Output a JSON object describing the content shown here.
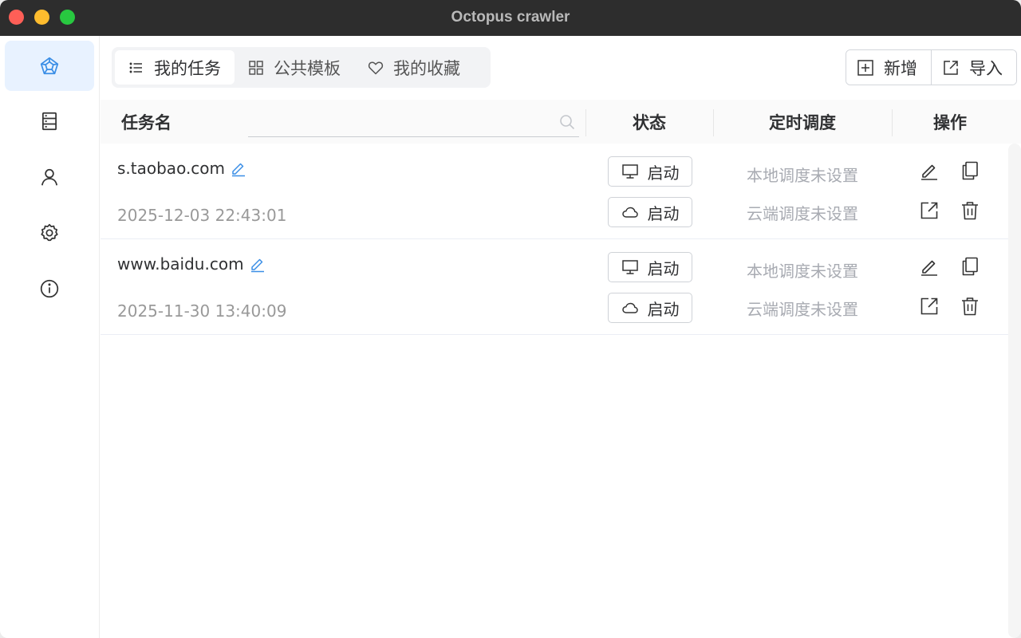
{
  "window": {
    "title": "Octopus crawler"
  },
  "sidebar": {
    "items": [
      {
        "icon": "octopus-logo-icon",
        "active": true
      },
      {
        "icon": "server-icon"
      },
      {
        "icon": "user-icon"
      },
      {
        "icon": "gear-icon"
      },
      {
        "icon": "info-icon"
      }
    ]
  },
  "tabs": [
    {
      "label": "我的任务",
      "icon": "list-icon",
      "active": true
    },
    {
      "label": "公共模板",
      "icon": "grid-icon"
    },
    {
      "label": "我的收藏",
      "icon": "heart-icon"
    }
  ],
  "actions": {
    "add_label": "新增",
    "import_label": "导入"
  },
  "table": {
    "headers": {
      "name": "任务名",
      "status": "状态",
      "schedule": "定时调度",
      "ops": "操作"
    },
    "search": {
      "value": "",
      "placeholder": ""
    },
    "rows": [
      {
        "name": "s.taobao.com",
        "time": "2025-12-03 22:43:01",
        "local_start": "启动",
        "cloud_start": "启动",
        "local_schedule": "本地调度未设置",
        "cloud_schedule": "云端调度未设置"
      },
      {
        "name": "www.baidu.com",
        "time": "2025-11-30 13:40:09",
        "local_start": "启动",
        "cloud_start": "启动",
        "local_schedule": "本地调度未设置",
        "cloud_schedule": "云端调度未设置"
      }
    ]
  },
  "colors": {
    "accent": "#3a8ee6",
    "active_bg": "#e8f2ff",
    "muted_text": "#a8abb2"
  }
}
